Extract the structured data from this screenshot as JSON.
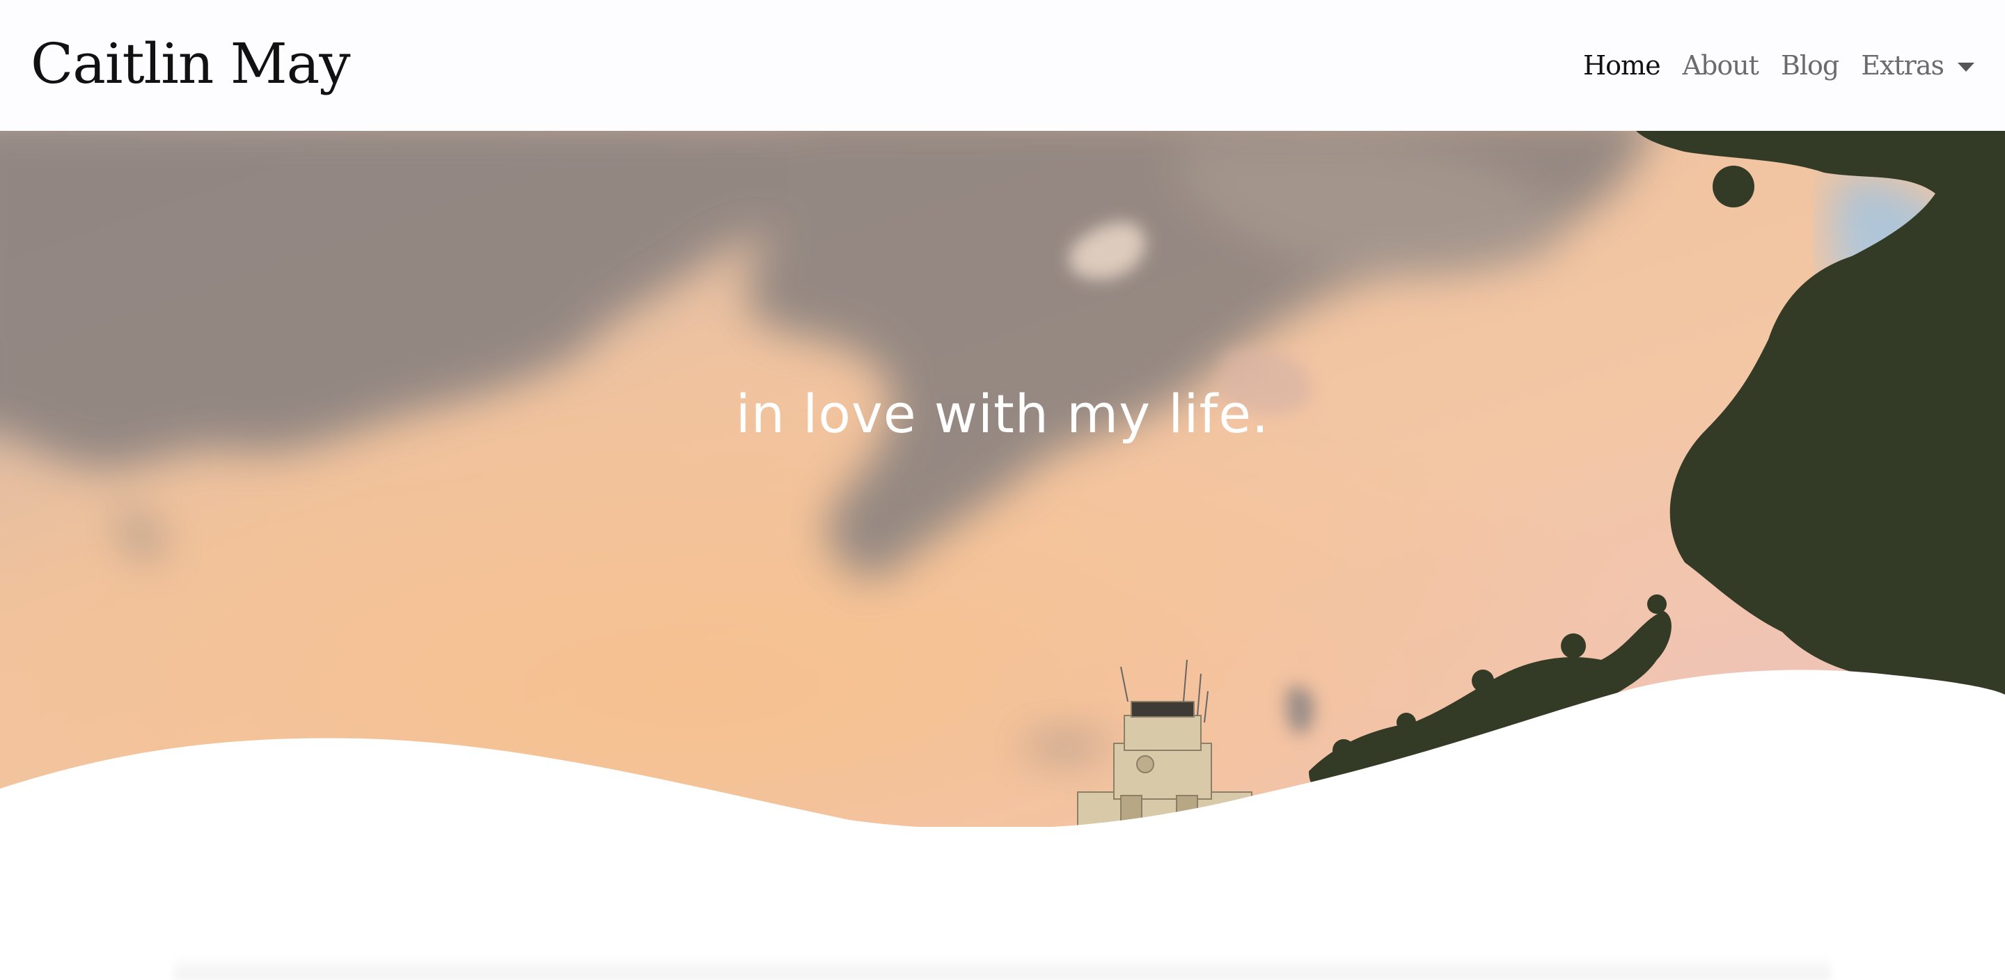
{
  "site": {
    "brand": "Caitlin May"
  },
  "nav": {
    "home": "Home",
    "about": "About",
    "blog": "Blog",
    "extras": "Extras"
  },
  "hero": {
    "tagline": "in love with my life."
  },
  "colors": {
    "navbar_bg": "#fdfcfe",
    "active_link": "#111111",
    "inactive_link": "#6b6b6b",
    "sky_warm": "#f3c4a0",
    "cloud_gray": "#8f8480",
    "tree_green": "#343b26"
  },
  "icons": {
    "dropdown": "chevron-down-icon"
  }
}
